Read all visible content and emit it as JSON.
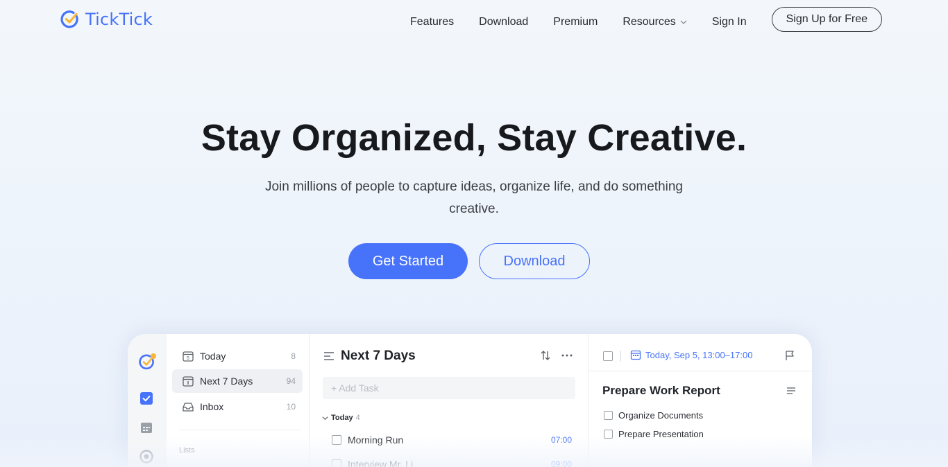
{
  "header": {
    "logo_text": "TickTick",
    "nav": [
      {
        "label": "Features"
      },
      {
        "label": "Download"
      },
      {
        "label": "Premium"
      },
      {
        "label": "Resources"
      },
      {
        "label": "Sign In"
      }
    ],
    "signup_label": "Sign Up for Free"
  },
  "hero": {
    "title": "Stay Organized, Stay Creative.",
    "subtitle": "Join millions of people to capture ideas, organize life, and do something creative.",
    "primary_cta": "Get Started",
    "secondary_cta": "Download"
  },
  "app": {
    "sidebar": {
      "items": [
        {
          "label": "Today",
          "count": "8"
        },
        {
          "label": "Next 7 Days",
          "count": "94"
        },
        {
          "label": "Inbox",
          "count": "10"
        }
      ],
      "section_label": "Lists"
    },
    "main": {
      "title": "Next 7 Days",
      "add_task_placeholder": "+ Add Task",
      "group": {
        "label": "Today",
        "count": "4"
      },
      "tasks": [
        {
          "title": "Morning Run",
          "time": "07:00"
        },
        {
          "title": "Interview Mr. Li",
          "time": "09:00"
        }
      ]
    },
    "detail": {
      "date": "Today, Sep 5, 13:00–17:00",
      "title": "Prepare Work Report",
      "subtasks": [
        {
          "title": "Organize Documents"
        },
        {
          "title": "Prepare Presentation"
        }
      ]
    }
  },
  "colors": {
    "accent": "#4772fa",
    "text": "#1f2329",
    "muted": "#9aa0a8",
    "badge": "#f8b637"
  }
}
